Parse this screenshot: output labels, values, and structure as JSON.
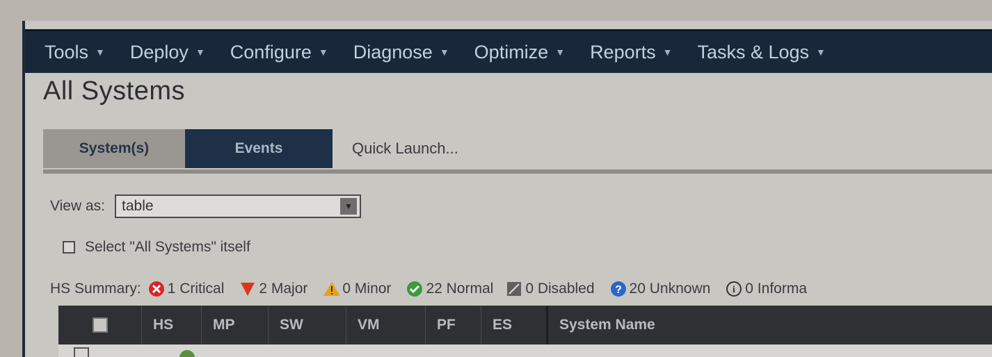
{
  "menu": [
    {
      "label": "Tools"
    },
    {
      "label": "Deploy"
    },
    {
      "label": "Configure"
    },
    {
      "label": "Diagnose"
    },
    {
      "label": "Optimize"
    },
    {
      "label": "Reports"
    },
    {
      "label": "Tasks & Logs"
    }
  ],
  "page": {
    "title": "All Systems"
  },
  "tabs": {
    "systems": "System(s)",
    "events": "Events",
    "quick_launch": "Quick Launch..."
  },
  "view_as": {
    "label": "View as:",
    "value": "table"
  },
  "select_all": {
    "label": "Select \"All Systems\" itself"
  },
  "hs_summary": {
    "label": "HS Summary:",
    "items": [
      {
        "text": "1 Critical",
        "icon": "critical-icon",
        "color": "#d6262a"
      },
      {
        "text": "2 Major",
        "icon": "major-icon",
        "color": "#d9371b"
      },
      {
        "text": "0 Minor",
        "icon": "minor-icon",
        "color": "#e5a21a"
      },
      {
        "text": "22 Normal",
        "icon": "normal-icon",
        "color": "#3d9a3d"
      },
      {
        "text": "0 Disabled",
        "icon": "disabled-icon",
        "color": "#666666"
      },
      {
        "text": "20 Unknown",
        "icon": "unknown-icon",
        "color": "#2a67c9"
      },
      {
        "text": "0 Informa",
        "icon": "info-icon",
        "color": "#333333"
      }
    ]
  },
  "table": {
    "columns": [
      "HS",
      "MP",
      "SW",
      "VM",
      "PF",
      "ES",
      "System Name"
    ]
  }
}
